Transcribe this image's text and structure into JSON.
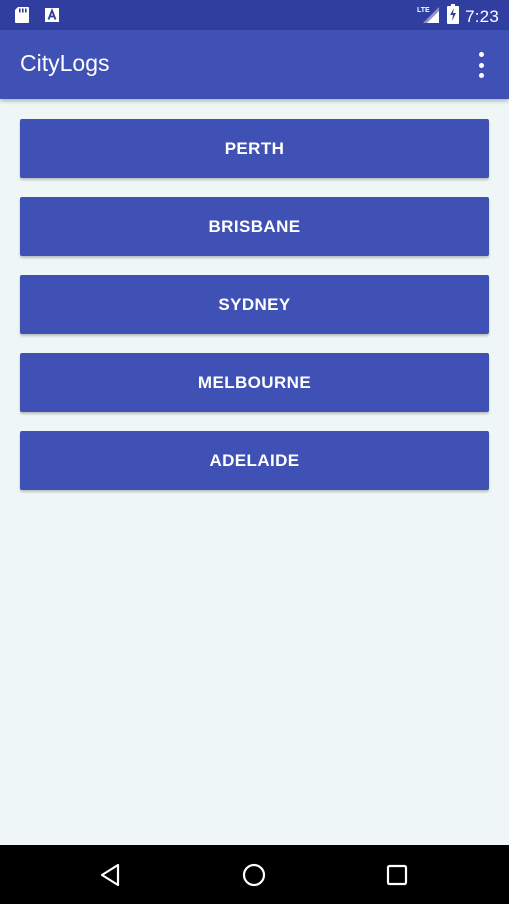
{
  "status_bar": {
    "time": "7:23",
    "network": "LTE",
    "icons": [
      "sd-card-icon",
      "keyboard-a-icon",
      "signal-icon",
      "battery-charging-icon"
    ]
  },
  "app_bar": {
    "title": "CityLogs",
    "menu_icon": "more-vert-icon"
  },
  "cities": [
    {
      "label": "PERTH"
    },
    {
      "label": "BRISBANE"
    },
    {
      "label": "SYDNEY"
    },
    {
      "label": "MELBOURNE"
    },
    {
      "label": "ADELAIDE"
    }
  ],
  "nav_bar": {
    "icons": [
      "back-icon",
      "home-icon",
      "recents-icon"
    ]
  },
  "colors": {
    "status_bar": "#303f9f",
    "primary": "#3f51b5",
    "background": "#eff7f6",
    "nav_bar": "#000000"
  }
}
